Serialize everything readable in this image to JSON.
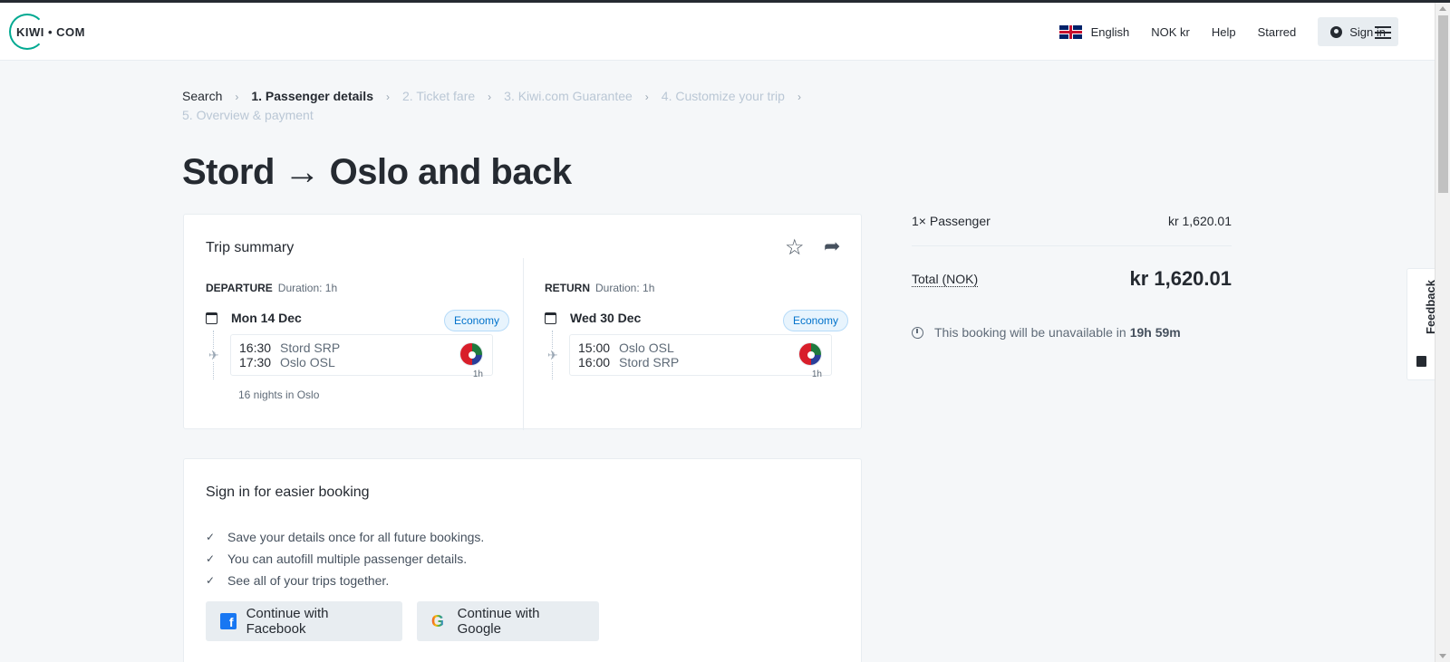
{
  "header": {
    "logo_text": "KIWI • COM",
    "language": "English",
    "currency": "NOK kr",
    "help": "Help",
    "starred": "Starred",
    "sign_in": "Sign in"
  },
  "breadcrumb": [
    {
      "label": "Search",
      "state": "done"
    },
    {
      "label": "1. Passenger details",
      "state": "active"
    },
    {
      "label": "2. Ticket fare",
      "state": "pending"
    },
    {
      "label": "3. Kiwi.com Guarantee",
      "state": "pending"
    },
    {
      "label": "4. Customize your trip",
      "state": "pending"
    },
    {
      "label": "5. Overview & payment",
      "state": "pending"
    }
  ],
  "page_title": "Stord → Oslo and back",
  "trip_summary": {
    "title": "Trip summary",
    "departure": {
      "label": "DEPARTURE",
      "duration": "Duration: 1h",
      "date": "Mon 14 Dec",
      "cabin": "Economy",
      "dep_time": "16:30",
      "dep_place": "Stord SRP",
      "arr_time": "17:30",
      "arr_place": "Oslo OSL",
      "seg_duration": "1h",
      "nights": "16 nights in Oslo"
    },
    "return": {
      "label": "RETURN",
      "duration": "Duration: 1h",
      "date": "Wed 30 Dec",
      "cabin": "Economy",
      "dep_time": "15:00",
      "dep_place": "Oslo OSL",
      "arr_time": "16:00",
      "arr_place": "Stord SRP",
      "seg_duration": "1h"
    }
  },
  "sign_in_card": {
    "title": "Sign in for easier booking",
    "benefits": [
      "Save your details once for all future bookings.",
      "You can autofill multiple passenger details.",
      "See all of your trips together."
    ],
    "facebook_btn": "Continue with Facebook",
    "google_btn": "Continue with Google"
  },
  "price": {
    "passenger_label": "1× Passenger",
    "passenger_price": "kr 1,620.01",
    "total_label": "Total (NOK)",
    "total_value": "kr 1,620.01",
    "timer_text": "This booking will be unavailable in",
    "timer_value": "19h 59m"
  },
  "feedback": "Feedback",
  "colors": {
    "brand": "#00a991",
    "text": "#252a31",
    "economy_badge": "#0172cb",
    "facebook": "#1877f2"
  },
  "icons": [
    "flag-uk-icon",
    "user-icon",
    "hamburger-icon",
    "star-icon",
    "share-icon",
    "calendar-icon",
    "plane-icon",
    "timer-icon",
    "facebook-icon",
    "google-icon",
    "check-icon"
  ]
}
